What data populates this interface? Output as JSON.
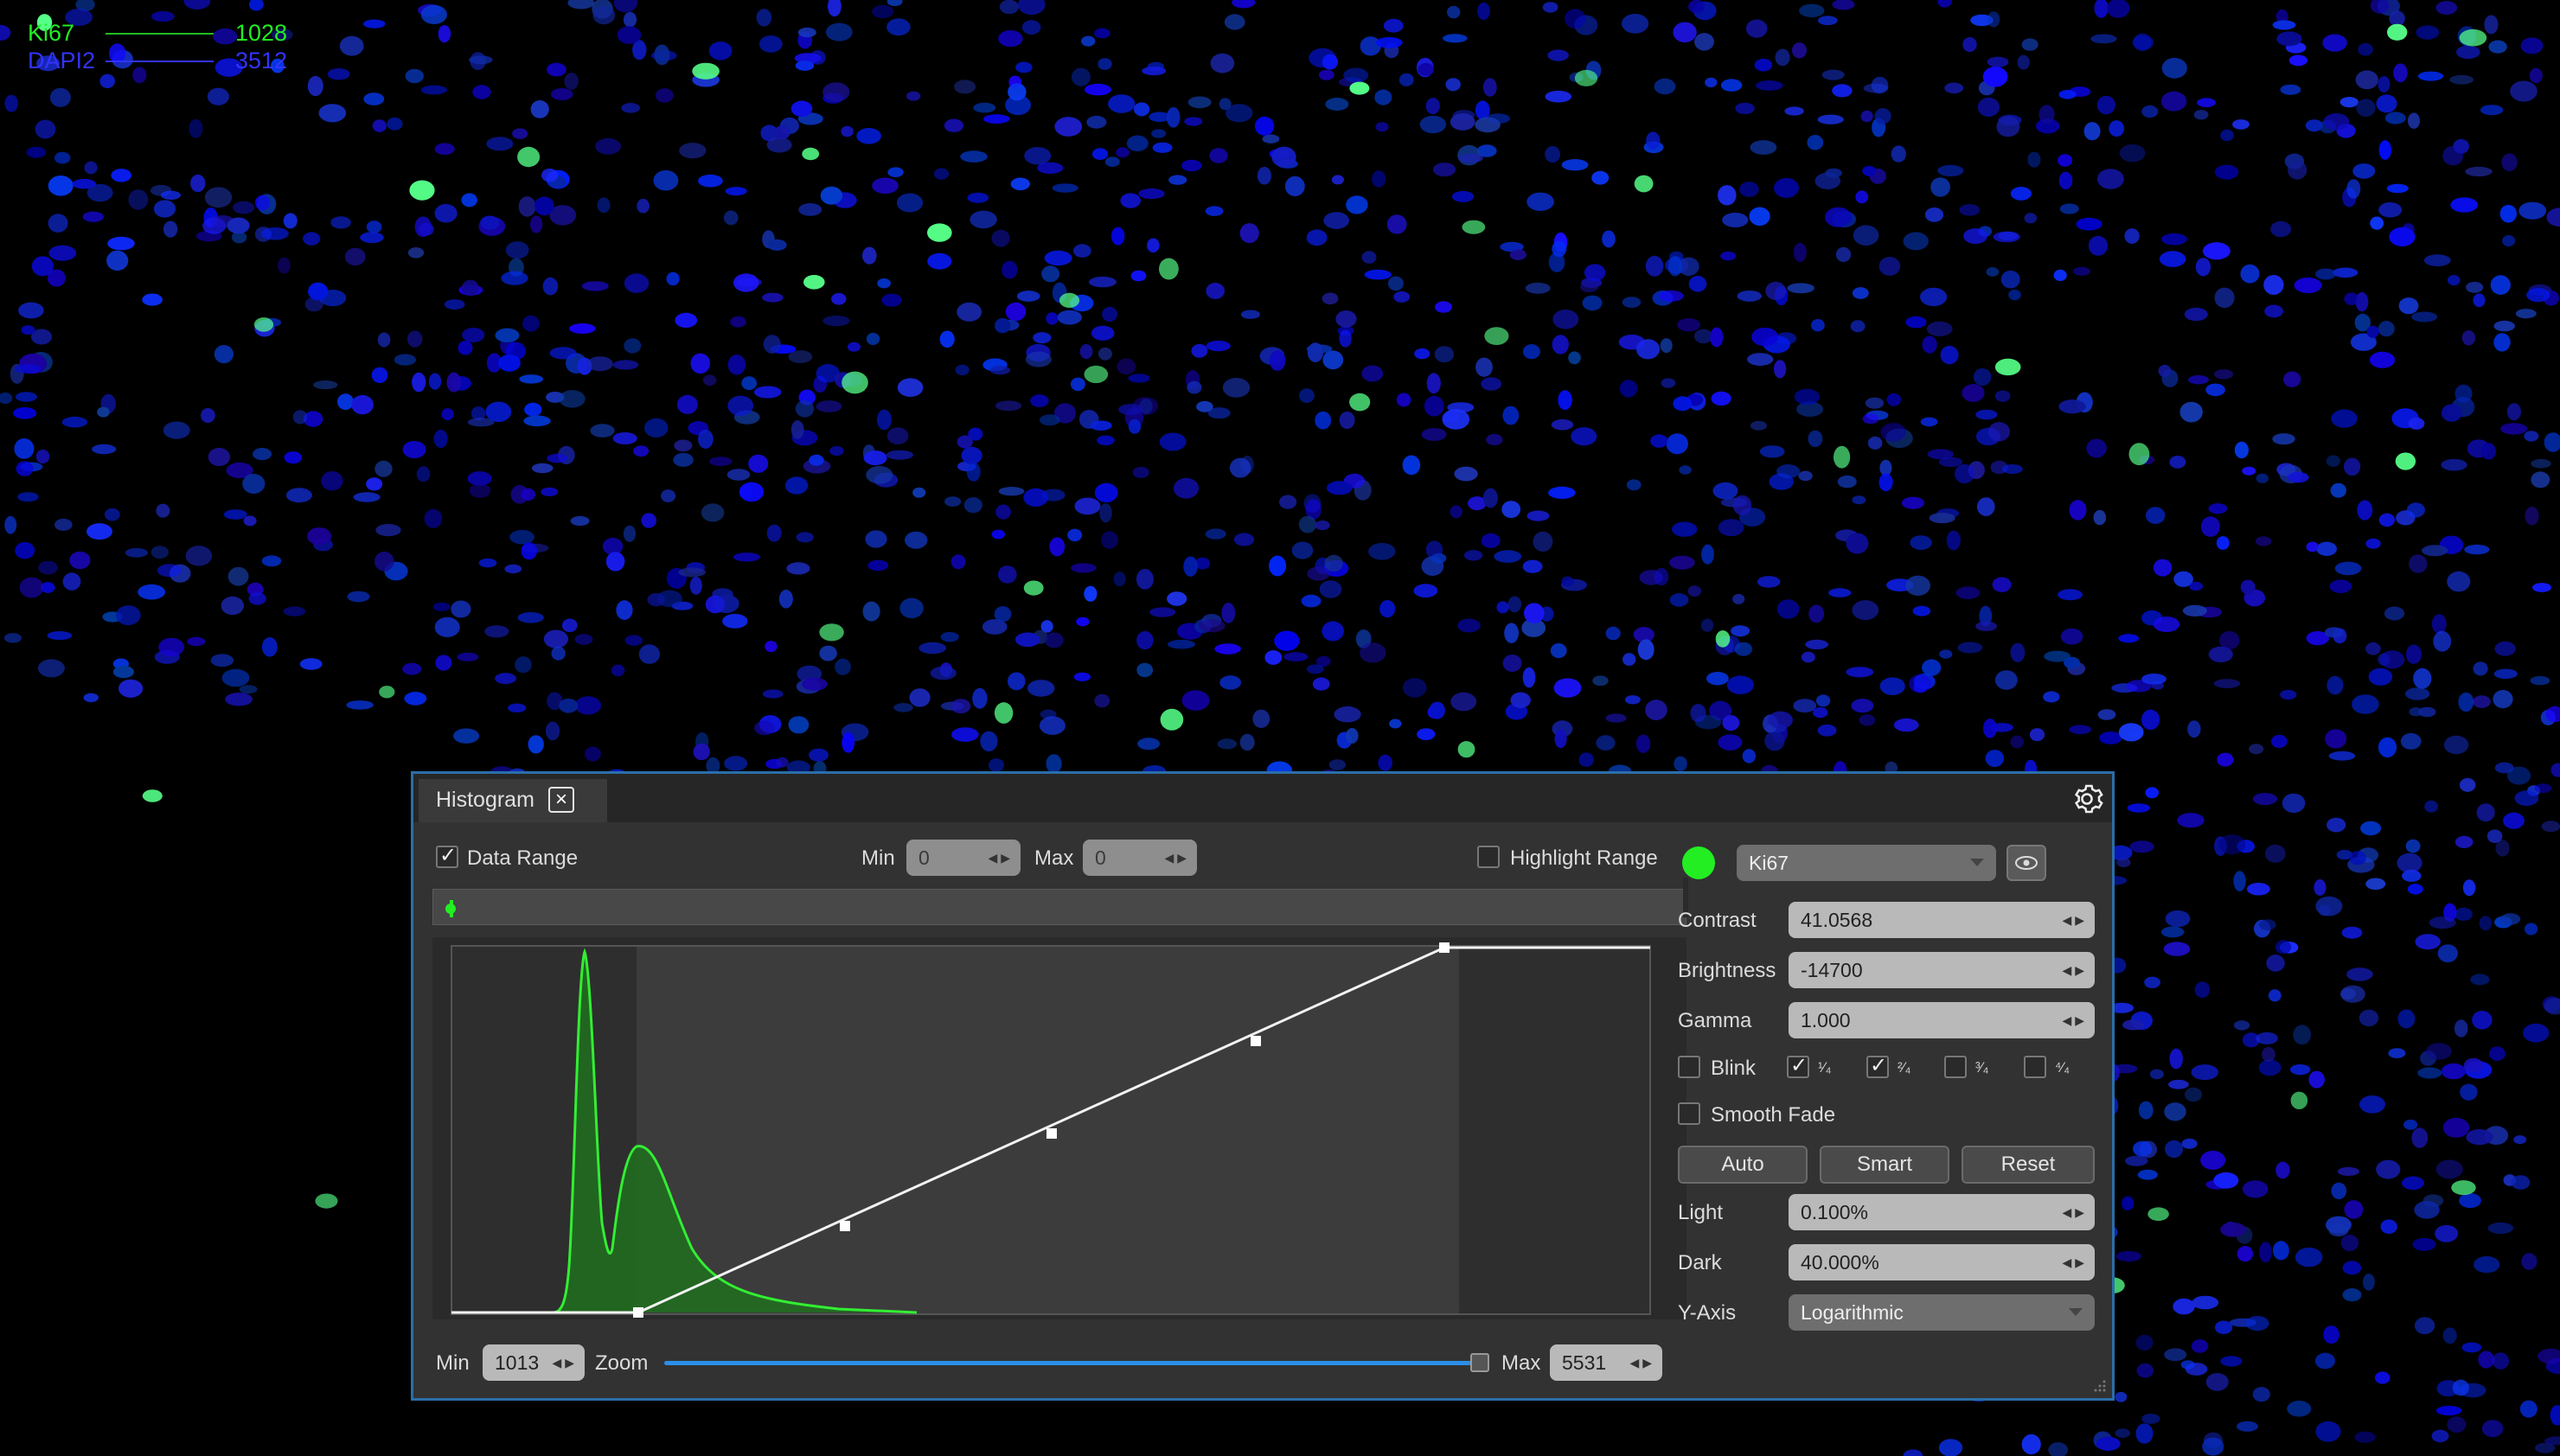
{
  "viewer": {
    "legend": [
      {
        "channel": "Ki67",
        "value": "1028",
        "color": "#22ee22"
      },
      {
        "channel": "DAPI2",
        "value": "3512",
        "color": "#3333ff"
      }
    ]
  },
  "histogram_panel": {
    "tab_label": "Histogram",
    "close_icon": "×",
    "data_range_label": "Data Range",
    "data_range_checked": true,
    "min_label": "Min",
    "min_value": "0",
    "max_label": "Max",
    "max_value": "0",
    "highlight_range_label": "Highlight Range",
    "highlight_range_checked": false,
    "bottom_min_label": "Min",
    "bottom_min_value": "1013",
    "zoom_label": "Zoom",
    "zoom_value": 1.0,
    "bottom_max_label": "Max",
    "bottom_max_value": "5531",
    "colors": {
      "channel": "#22ee22",
      "accent": "#2b8fe8",
      "panel": "#323232"
    }
  },
  "controls": {
    "channel_color": "#22ee22",
    "channel_select": "Ki67",
    "contrast_label": "Contrast",
    "contrast_value": "41.0568",
    "brightness_label": "Brightness",
    "brightness_value": "-14700",
    "gamma_label": "Gamma",
    "gamma_value": "1.000",
    "blink_label": "Blink",
    "quarters": [
      {
        "label": "¹⁄₄",
        "checked": true
      },
      {
        "label": "²⁄₄",
        "checked": true
      },
      {
        "label": "³⁄₄",
        "checked": false
      },
      {
        "label": "⁴⁄₄",
        "checked": false
      }
    ],
    "smooth_fade_label": "Smooth Fade",
    "auto_label": "Auto",
    "smart_label": "Smart",
    "reset_label": "Reset",
    "light_label": "Light",
    "light_value": "0.100%",
    "dark_label": "Dark",
    "dark_value": "40.000%",
    "yaxis_label": "Y-Axis",
    "yaxis_value": "Logarithmic"
  }
}
